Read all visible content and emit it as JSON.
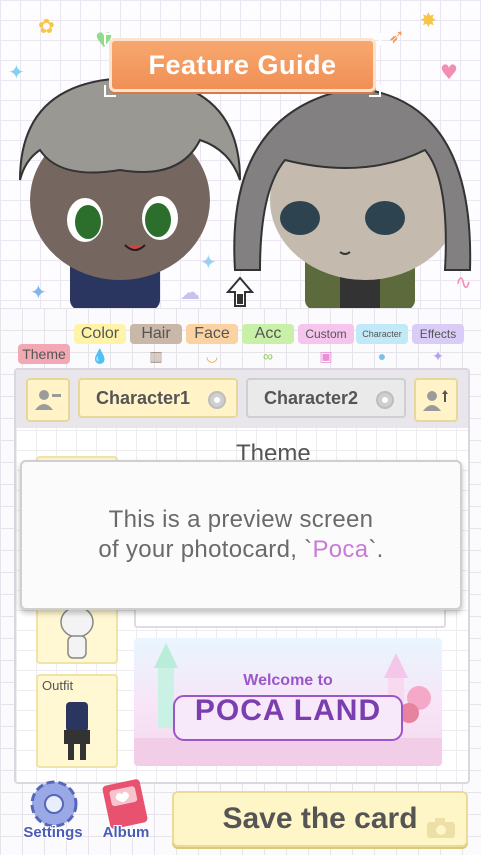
{
  "preview": {
    "guide_button": "Feature Guide"
  },
  "tabs": [
    {
      "label": "Theme",
      "color": "#f3a9b3",
      "icon": "theme-icon"
    },
    {
      "label": "Color",
      "color": "#fff3a8",
      "icon": "color-drop-icon"
    },
    {
      "label": "Hair",
      "color": "#c9b8a8",
      "icon": "comb-icon"
    },
    {
      "label": "Face",
      "color": "#fbd3a2",
      "icon": "face-icon"
    },
    {
      "label": "Acc",
      "color": "#c9f0a8",
      "icon": "glasses-icon"
    },
    {
      "label": "Custom",
      "color": "#f6c5ee",
      "icon": "image-icon"
    },
    {
      "label": "Character",
      "color": "#c2e9f7",
      "icon": "person-icon"
    },
    {
      "label": "Effects",
      "color": "#d9cdf7",
      "icon": "sparkle-icon"
    }
  ],
  "character_bar": {
    "character1": "Character1",
    "character2": "Character2",
    "selected": "Character1"
  },
  "panel": {
    "theme_title": "Theme",
    "outfit_label": "Outfit",
    "banner_line1": "Welcome to",
    "banner_line2": "POCA LAND"
  },
  "tooltip": {
    "line1": "This is a preview screen",
    "line2_before": "of your photocard, `",
    "line2_highlight": "Poca",
    "line2_after": "`."
  },
  "bottom": {
    "settings_label": "Settings",
    "album_label": "Album",
    "save_label": "Save the card"
  },
  "colors": {
    "accent_orange": "#f29a5e",
    "highlight_purple": "#c77ad6",
    "save_bg": "#fff6c8"
  }
}
